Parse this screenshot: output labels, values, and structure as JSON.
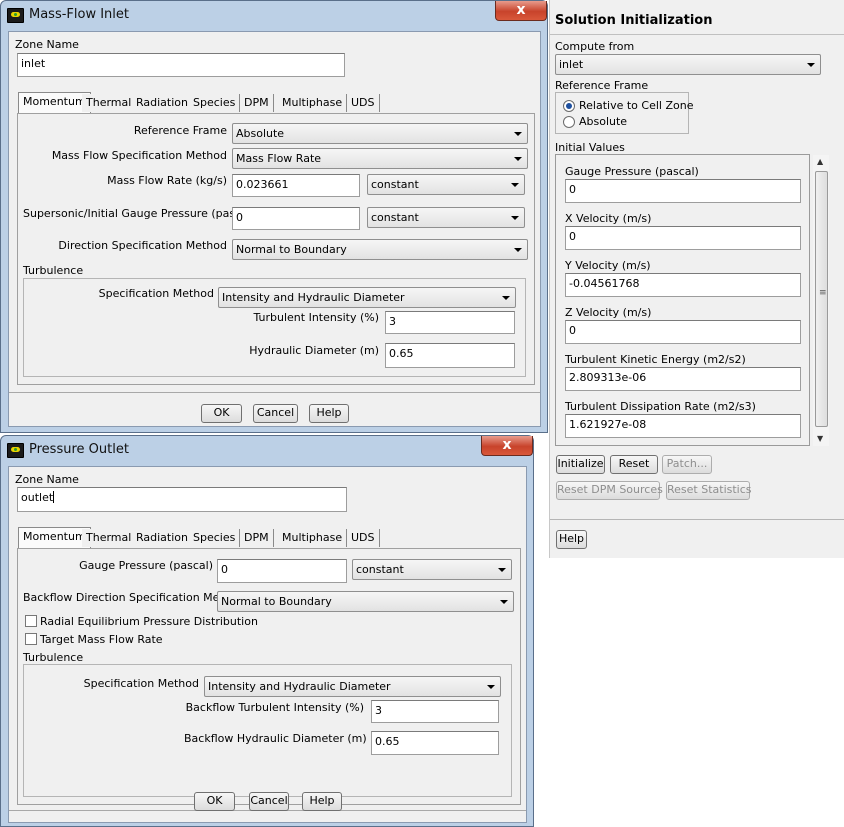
{
  "inlet_dialog": {
    "title": "Mass-Flow Inlet",
    "close_label": "x",
    "zone_name_label": "Zone Name",
    "zone_name_value": "inlet",
    "tabs": [
      "Momentum",
      "Thermal",
      "Radiation",
      "Species",
      "DPM",
      "Multiphase",
      "UDS"
    ],
    "reference_frame_label": "Reference Frame",
    "reference_frame_value": "Absolute",
    "mass_flow_spec_label": "Mass Flow Specification Method",
    "mass_flow_spec_value": "Mass Flow Rate",
    "mass_flow_rate_label": "Mass Flow Rate (kg/s)",
    "mass_flow_rate_value": "0.023661",
    "mass_flow_rate_profile": "constant",
    "gauge_pressure_label": "Supersonic/Initial Gauge Pressure (pascal)",
    "gauge_pressure_value": "0",
    "gauge_pressure_profile": "constant",
    "direction_spec_label": "Direction Specification Method",
    "direction_spec_value": "Normal to Boundary",
    "turbulence_label": "Turbulence",
    "turb_spec_label": "Specification Method",
    "turb_spec_value": "Intensity and Hydraulic Diameter",
    "turb_intensity_label": "Turbulent Intensity (%)",
    "turb_intensity_value": "3",
    "hydraulic_diameter_label": "Hydraulic Diameter (m)",
    "hydraulic_diameter_value": "0.65",
    "ok_label": "OK",
    "cancel_label": "Cancel",
    "help_label": "Help"
  },
  "outlet_dialog": {
    "title": "Pressure Outlet",
    "close_label": "x",
    "zone_name_label": "Zone Name",
    "zone_name_value": "outlet",
    "tabs": [
      "Momentum",
      "Thermal",
      "Radiation",
      "Species",
      "DPM",
      "Multiphase",
      "UDS"
    ],
    "gauge_pressure_label": "Gauge Pressure (pascal)",
    "gauge_pressure_value": "0",
    "gauge_pressure_profile": "constant",
    "backflow_dir_label": "Backflow Direction Specification Method",
    "backflow_dir_value": "Normal to Boundary",
    "radial_eq_label": "Radial Equilibrium Pressure Distribution",
    "target_mass_label": "Target Mass Flow Rate",
    "turbulence_label": "Turbulence",
    "turb_spec_label": "Specification Method",
    "turb_spec_value": "Intensity and Hydraulic Diameter",
    "backflow_intensity_label": "Backflow Turbulent Intensity (%)",
    "backflow_intensity_value": "3",
    "backflow_diameter_label": "Backflow Hydraulic Diameter (m)",
    "backflow_diameter_value": "0.65",
    "ok_label": "OK",
    "cancel_label": "Cancel",
    "help_label": "Help"
  },
  "solution_init": {
    "title": "Solution Initialization",
    "compute_from_label": "Compute from",
    "compute_from_value": "inlet",
    "reference_frame_label": "Reference Frame",
    "relative_label": "Relative to Cell Zone",
    "absolute_label": "Absolute",
    "initial_values_label": "Initial Values",
    "fields": [
      {
        "label": "Gauge Pressure (pascal)",
        "value": "0"
      },
      {
        "label": "X Velocity (m/s)",
        "value": "0"
      },
      {
        "label": "Y Velocity (m/s)",
        "value": "-0.04561768"
      },
      {
        "label": "Z Velocity (m/s)",
        "value": "0"
      },
      {
        "label": "Turbulent Kinetic Energy (m2/s2)",
        "value": "2.809313e-06"
      },
      {
        "label": "Turbulent Dissipation Rate (m2/s3)",
        "value": "1.621927e-08"
      }
    ],
    "initialize_label": "Initialize",
    "reset_label": "Reset",
    "patch_label": "Patch...",
    "reset_dpm_label": "Reset DPM Sources",
    "reset_stats_label": "Reset Statistics",
    "help_label": "Help"
  }
}
